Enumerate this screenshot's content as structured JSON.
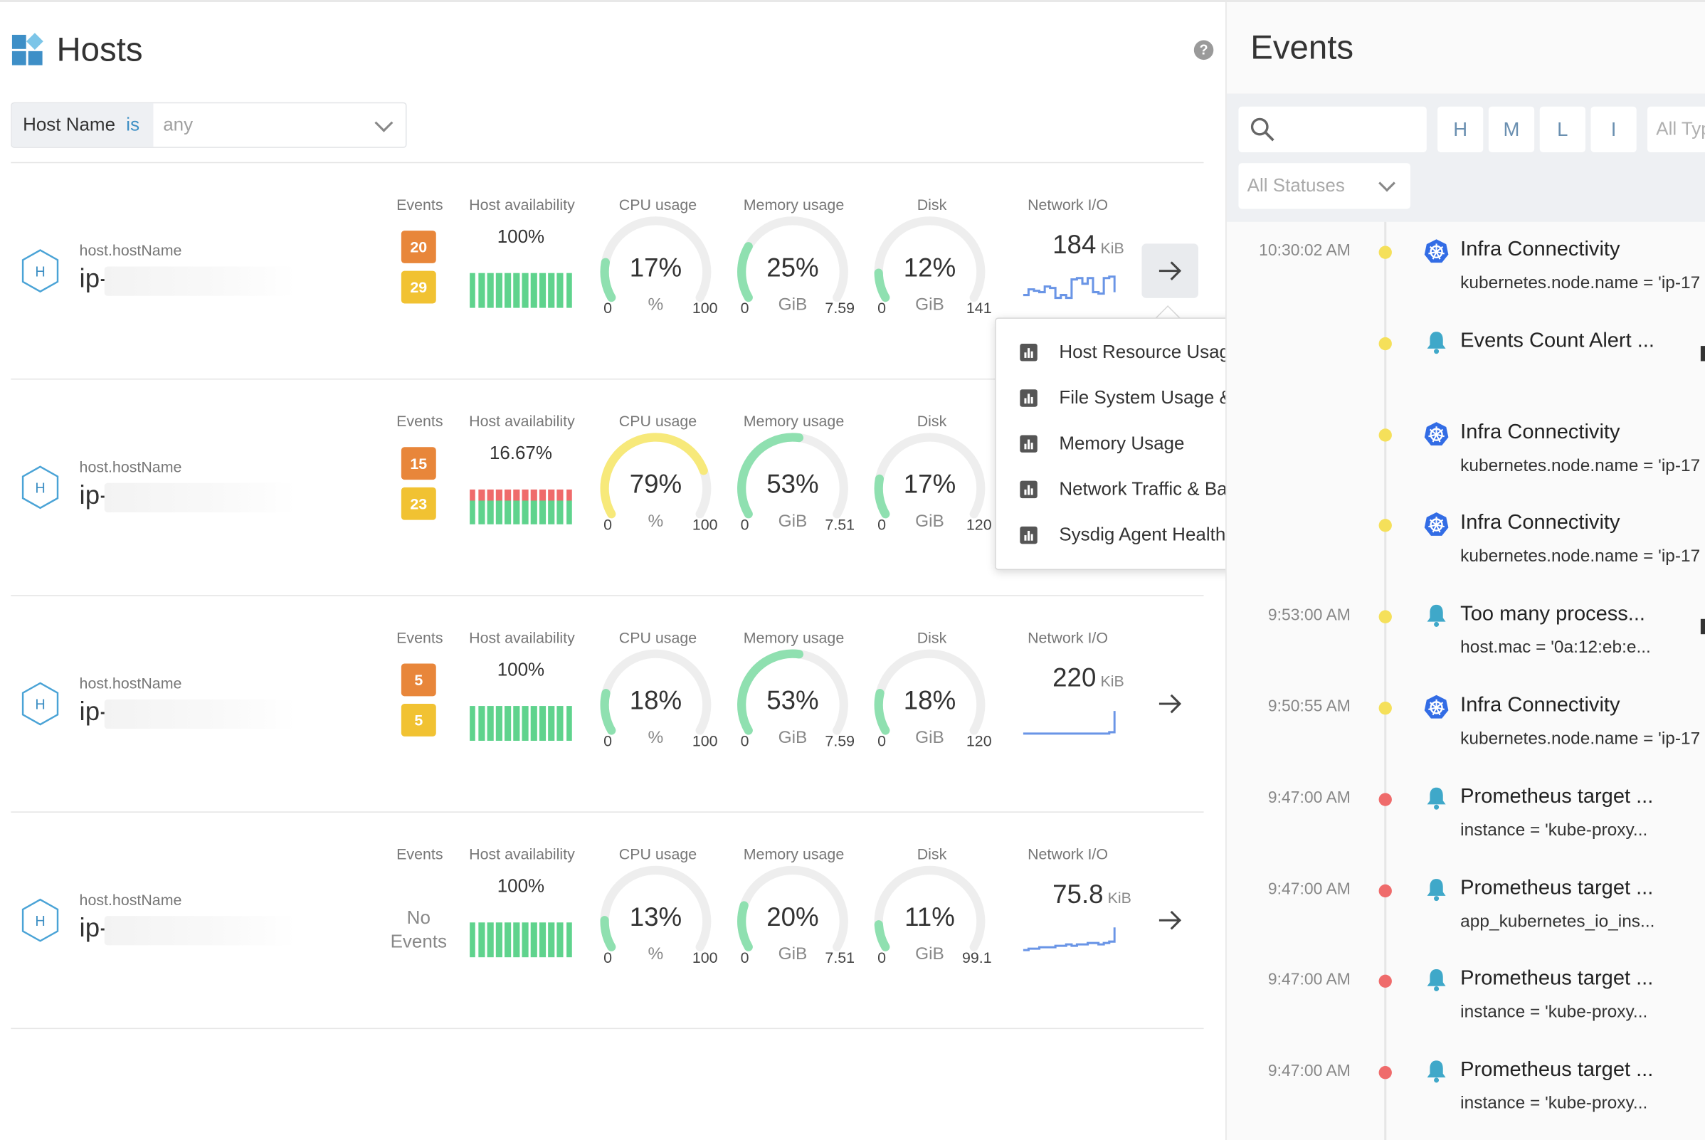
{
  "colors": {
    "accent": "#3d8fc4",
    "gauge_green": "#8fe0b0",
    "gauge_yellow": "#f7e97a",
    "gauge_track": "#eeeeee",
    "avail_green": "#5fd38d",
    "avail_red": "#ef6b6b",
    "badge_high": "#e8863a",
    "badge_medium": "#f1c232",
    "dot_yellow": "#f5e05a",
    "dot_red": "#ef6b6b",
    "spark_blue": "#6a95e6"
  },
  "hosts": {
    "title": "Hosts",
    "logo_icon": "hosts-grid-icon",
    "help_icon": "?",
    "filter": {
      "key": "Host Name",
      "operator": "is",
      "value": "any"
    },
    "column_labels": {
      "events": "Events",
      "availability": "Host availability",
      "cpu": "CPU usage",
      "memory": "Memory usage",
      "disk": "Disk",
      "network": "Network I/O"
    },
    "rows": [
      {
        "host_icon": "H",
        "label": "host.hostName",
        "name": "ip-",
        "events": {
          "high": "20",
          "medium": "29"
        },
        "availability": "100%",
        "availability_bars": "gggggggggggg",
        "cpu": {
          "value": "17%",
          "fraction": 0.17,
          "min": "0",
          "unit": "%",
          "max": "100"
        },
        "memory": {
          "value": "25%",
          "fraction": 0.25,
          "min": "0",
          "unit": "GiB",
          "max": "7.59"
        },
        "disk": {
          "value": "12%",
          "fraction": 0.12,
          "min": "0",
          "unit": "GiB",
          "max": "141"
        },
        "network": {
          "value": "184",
          "unit": "KiB",
          "spark": [
            0.3,
            0.5,
            0.45,
            0.4,
            0.6,
            0.55,
            0.2,
            0.3,
            0.2,
            0.85,
            0.9,
            0.7,
            0.9,
            0.4,
            0.35,
            0.9,
            0.95,
            0.4
          ]
        },
        "arrow_active": true
      },
      {
        "host_icon": "H",
        "label": "host.hostName",
        "name": "ip-",
        "events": {
          "high": "15",
          "medium": "23"
        },
        "availability": "16.67%",
        "availability_bars": "rrrrrrrrrrrr",
        "cpu": {
          "value": "79%",
          "fraction": 0.79,
          "min": "0",
          "unit": "%",
          "max": "100",
          "warn": true
        },
        "memory": {
          "value": "53%",
          "fraction": 0.53,
          "min": "0",
          "unit": "GiB",
          "max": "7.51"
        },
        "disk": {
          "value": "17%",
          "fraction": 0.17,
          "min": "0",
          "unit": "GiB",
          "max": "120"
        },
        "network": {
          "value": "",
          "unit": "",
          "spark": []
        },
        "arrow_active": false
      },
      {
        "host_icon": "H",
        "label": "host.hostName",
        "name": "ip-",
        "events": {
          "high": "5",
          "medium": "5"
        },
        "availability": "100%",
        "availability_bars": "gggggggggggg",
        "cpu": {
          "value": "18%",
          "fraction": 0.18,
          "min": "0",
          "unit": "%",
          "max": "100"
        },
        "memory": {
          "value": "53%",
          "fraction": 0.53,
          "min": "0",
          "unit": "GiB",
          "max": "7.59"
        },
        "disk": {
          "value": "18%",
          "fraction": 0.18,
          "min": "0",
          "unit": "GiB",
          "max": "120"
        },
        "network": {
          "value": "220",
          "unit": "KiB",
          "spark": [
            0.1,
            0.1,
            0.1,
            0.1,
            0.1,
            0.1,
            0.1,
            0.1,
            0.1,
            0.1,
            0.1,
            0.1,
            0.1,
            0.1,
            0.1,
            0.1,
            0.15,
            0.9
          ]
        },
        "arrow_active": false
      },
      {
        "host_icon": "H",
        "label": "host.hostName",
        "name": "ip-",
        "events": {
          "none": "No Events"
        },
        "availability": "100%",
        "availability_bars": "gggggggggggg",
        "cpu": {
          "value": "13%",
          "fraction": 0.13,
          "min": "0",
          "unit": "%",
          "max": "100"
        },
        "memory": {
          "value": "20%",
          "fraction": 0.2,
          "min": "0",
          "unit": "GiB",
          "max": "7.51"
        },
        "disk": {
          "value": "11%",
          "fraction": 0.11,
          "min": "0",
          "unit": "GiB",
          "max": "99.1"
        },
        "network": {
          "value": "75.8",
          "unit": "KiB",
          "spark": [
            0.1,
            0.15,
            0.15,
            0.2,
            0.2,
            0.2,
            0.25,
            0.25,
            0.3,
            0.25,
            0.3,
            0.3,
            0.35,
            0.35,
            0.3,
            0.35,
            0.4,
            0.9
          ]
        },
        "arrow_active": false
      }
    ],
    "dropdown": {
      "items": [
        "Host Resource Usage",
        "File System Usage & Performance",
        "Memory Usage",
        "Network Traffic & Bandwidth",
        "Sysdig Agent Health & Status"
      ]
    }
  },
  "events": {
    "title": "Events",
    "search_icon": "search-icon",
    "severity_buttons": [
      "H",
      "M",
      "L",
      "I"
    ],
    "type_filter": "All Typ",
    "status_filter": "All Statuses",
    "items": [
      {
        "time": "10:30:02 AM",
        "severity": "yellow",
        "icon": "kubernetes-icon",
        "name": "Infra Connectivity",
        "sub": "kubernetes.node.name = 'ip-17",
        "mark": false
      },
      {
        "time": "",
        "severity": "yellow",
        "icon": "bell-icon",
        "name": "Events Count Alert ...",
        "sub": "",
        "mark": true
      },
      {
        "time": "",
        "severity": "yellow",
        "icon": "kubernetes-icon",
        "name": "Infra Connectivity",
        "sub": "kubernetes.node.name = 'ip-17",
        "mark": false
      },
      {
        "time": "",
        "severity": "yellow",
        "icon": "kubernetes-icon",
        "name": "Infra Connectivity",
        "sub": "kubernetes.node.name = 'ip-17",
        "mark": false
      },
      {
        "time": "9:53:00 AM",
        "severity": "yellow",
        "icon": "bell-icon",
        "name": "Too many process...",
        "sub": "host.mac = '0a:12:eb:e...",
        "mark": true
      },
      {
        "time": "9:50:55 AM",
        "severity": "yellow",
        "icon": "kubernetes-icon",
        "name": "Infra Connectivity",
        "sub": "kubernetes.node.name = 'ip-17",
        "mark": false
      },
      {
        "time": "9:47:00 AM",
        "severity": "red",
        "icon": "bell-icon",
        "name": "Prometheus target ...",
        "sub": "instance = 'kube-proxy...",
        "mark": false
      },
      {
        "time": "9:47:00 AM",
        "severity": "red",
        "icon": "bell-icon",
        "name": "Prometheus target ...",
        "sub": "app_kubernetes_io_ins...",
        "mark": false
      },
      {
        "time": "9:47:00 AM",
        "severity": "red",
        "icon": "bell-icon",
        "name": "Prometheus target ...",
        "sub": "instance = 'kube-proxy...",
        "mark": false
      },
      {
        "time": "9:47:00 AM",
        "severity": "red",
        "icon": "bell-icon",
        "name": "Prometheus target ...",
        "sub": "instance = 'kube-proxy...",
        "mark": false
      }
    ]
  }
}
